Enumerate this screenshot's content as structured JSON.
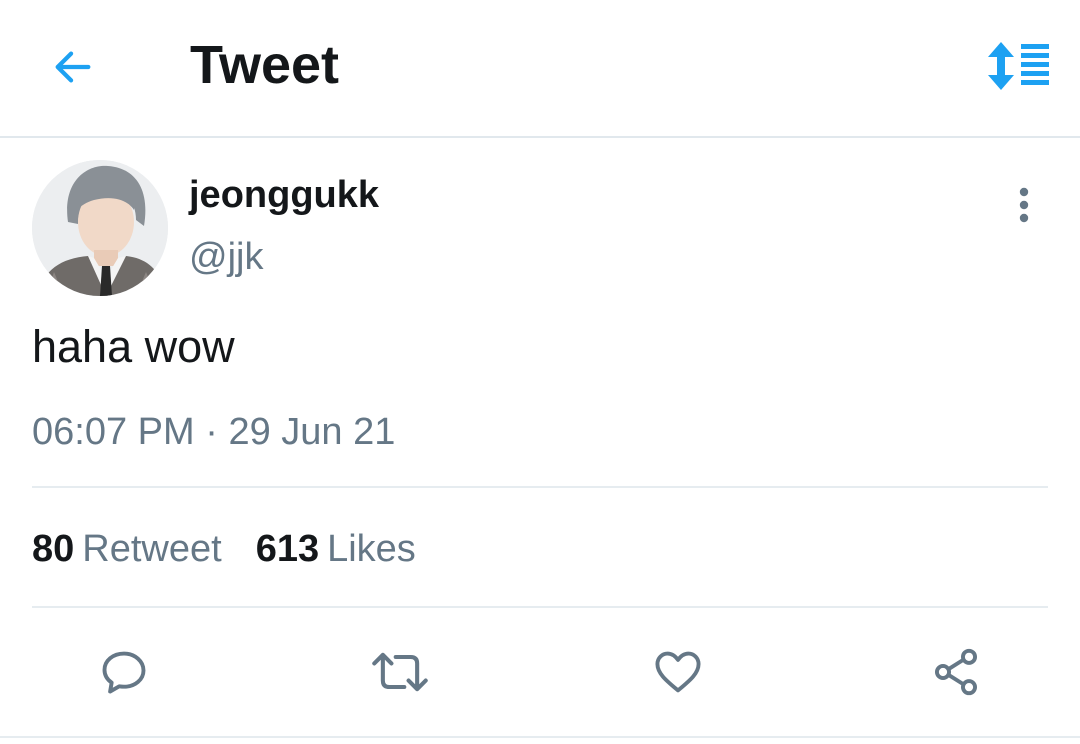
{
  "header": {
    "title": "Tweet",
    "back_icon": "arrow-left-icon",
    "sort_icon": "sort-list-icon",
    "accent_color": "#1da1f2"
  },
  "tweet": {
    "display_name": "jeonggukk",
    "handle": "@jjk",
    "text": "haha wow",
    "time": "06:07 PM",
    "separator": "·",
    "date": "29 Jun 21"
  },
  "stats": {
    "retweets_count": "80",
    "retweets_label": "Retweet",
    "likes_count": "613",
    "likes_label": "Likes"
  },
  "actions": [
    "reply-icon",
    "retweet-icon",
    "like-icon",
    "share-icon"
  ]
}
